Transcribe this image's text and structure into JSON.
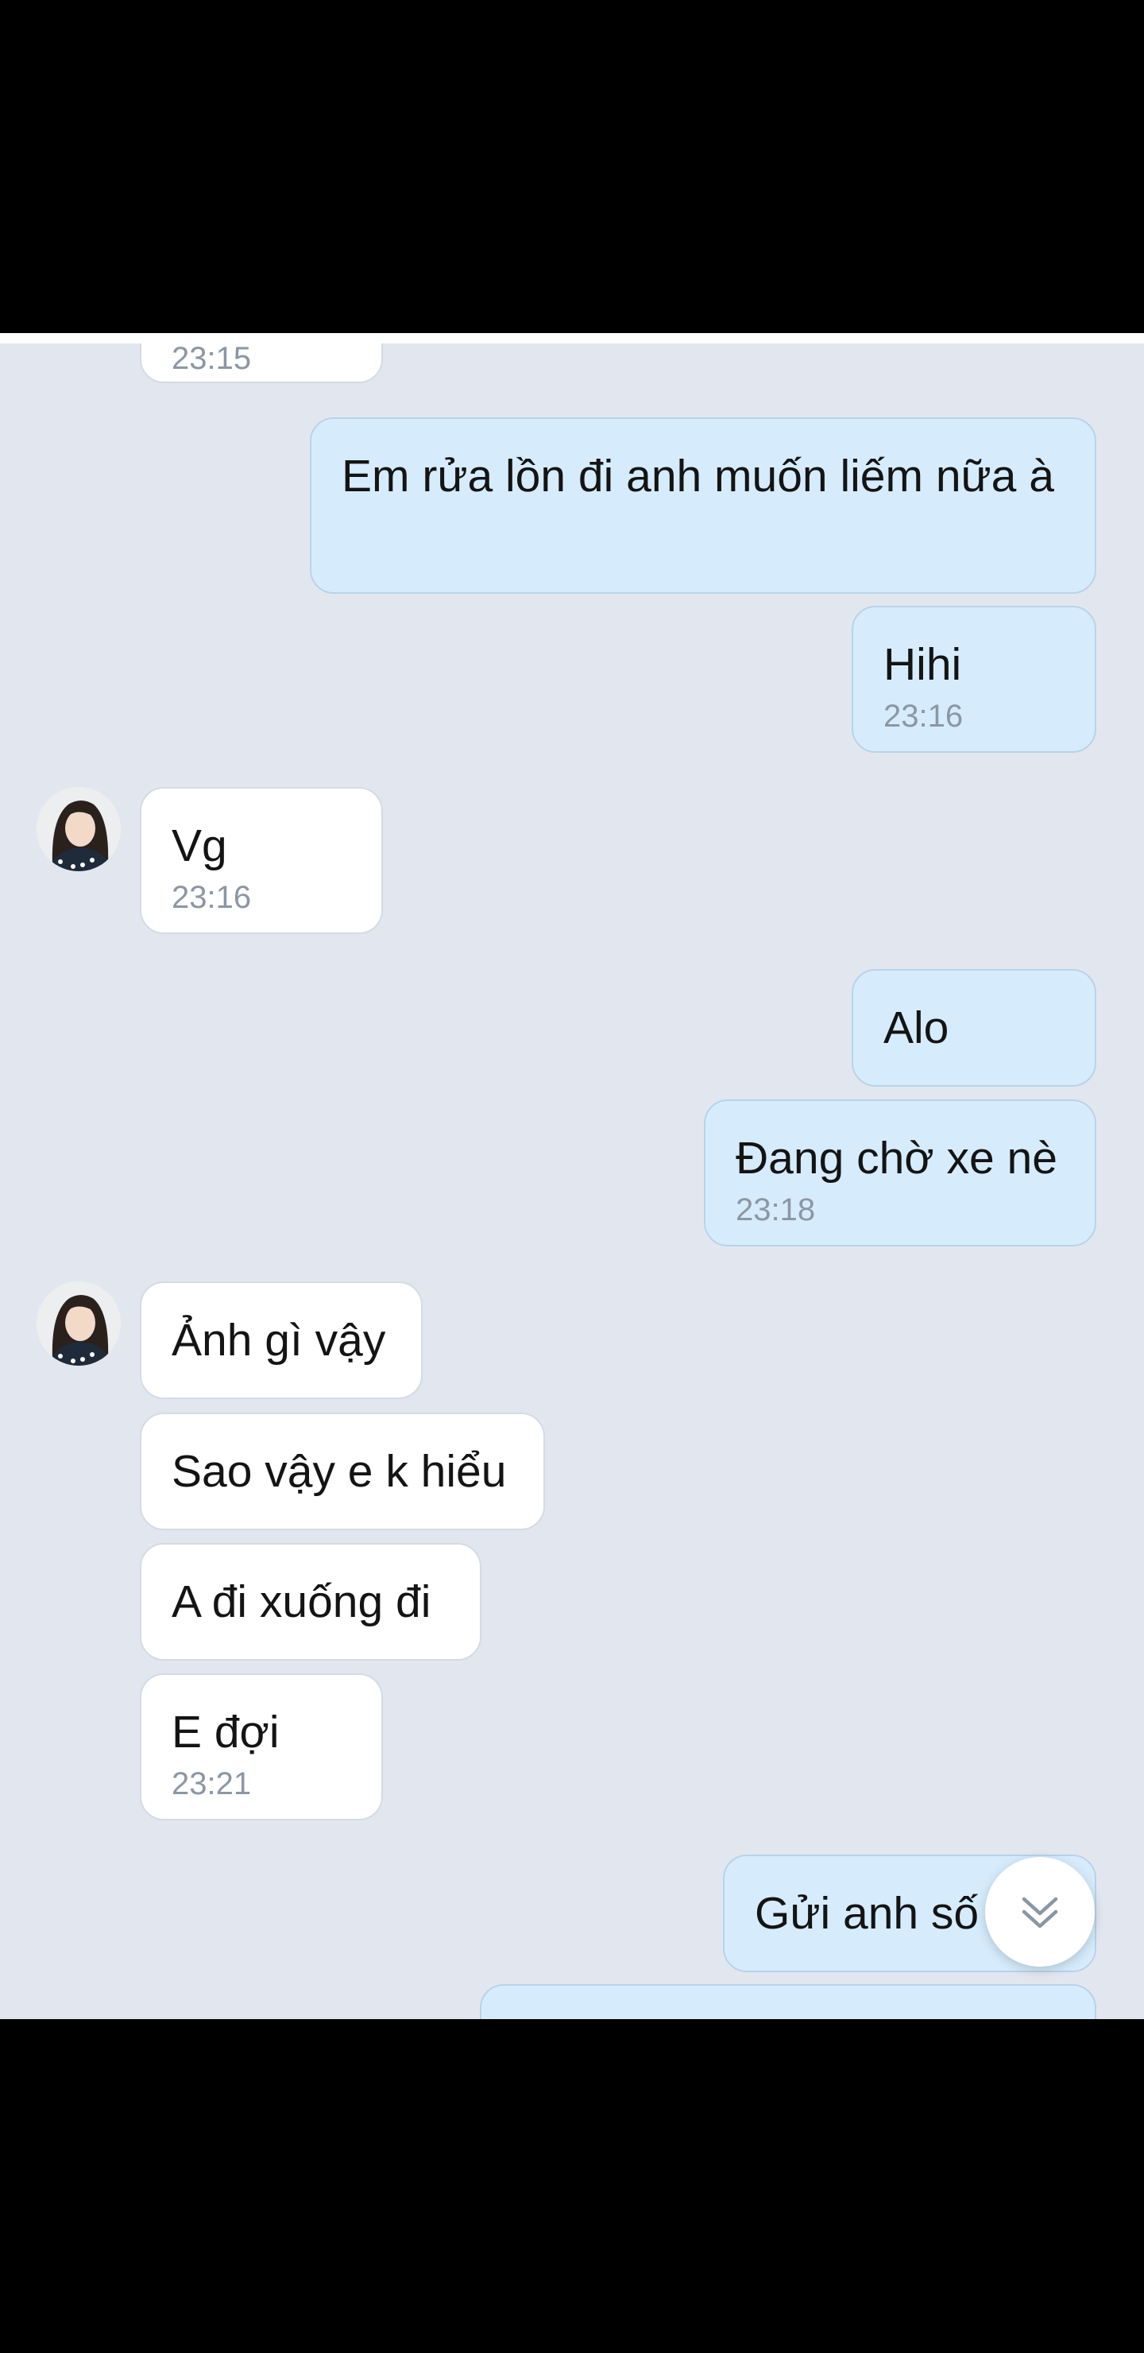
{
  "chat": {
    "messages": [
      {
        "side": "in",
        "time": "23:15"
      },
      {
        "side": "out",
        "text": "Em rửa lồn đi anh muốn liếm nữa à"
      },
      {
        "side": "out",
        "text": "Hihi",
        "time": "23:16"
      },
      {
        "side": "in",
        "text": "Vg",
        "time": "23:16"
      },
      {
        "side": "out",
        "text": "Alo"
      },
      {
        "side": "out",
        "text": "Đang chờ xe nè",
        "time": "23:18"
      },
      {
        "side": "in",
        "text": "Ảnh gì vậy"
      },
      {
        "side": "in",
        "text": "Sao vậy e k hiểu"
      },
      {
        "side": "in",
        "text": "A đi xuống đi"
      },
      {
        "side": "in",
        "text": "E đợi",
        "time": "23:21"
      },
      {
        "side": "out",
        "text": "Gửi anh số"
      }
    ]
  },
  "icons": {
    "avatar": "contact-avatar",
    "scroll_down": "double-chevron-down-icon"
  },
  "colors": {
    "chat_background": "#e2e7ef",
    "incoming_bubble": "#ffffff",
    "outgoing_bubble": "#d6ecfc",
    "timestamp": "#8c97a3"
  }
}
